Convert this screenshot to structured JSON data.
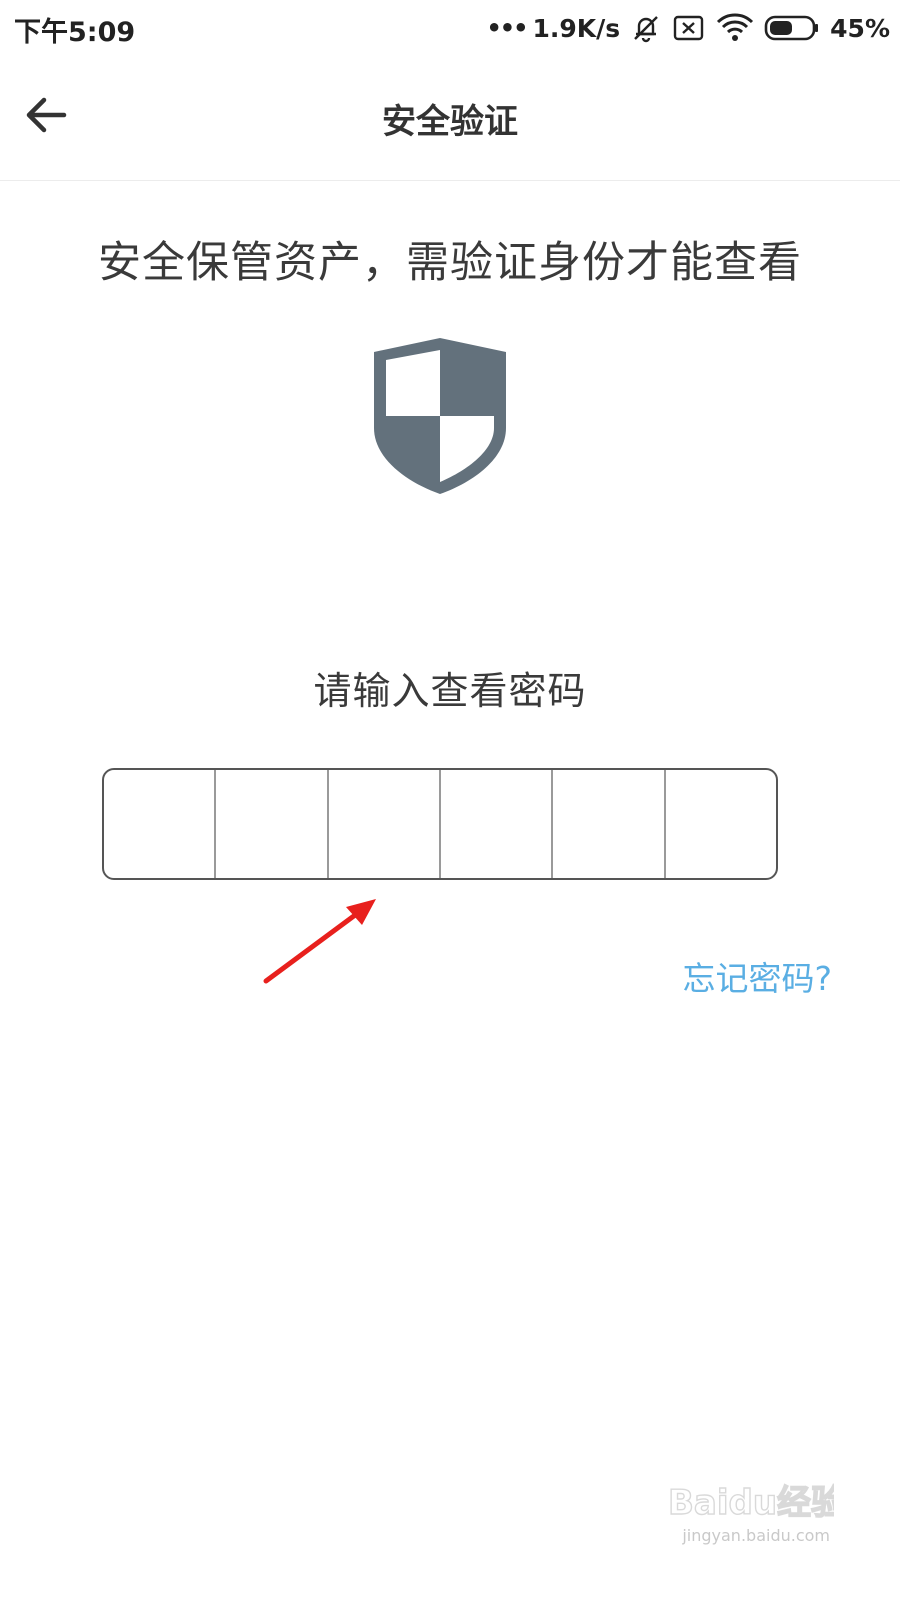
{
  "status_bar": {
    "time": "下午5:09",
    "signal_dots": "•••",
    "network_speed": "1.9K/s",
    "battery_percent": "45%",
    "icons": [
      "mute-bell-icon",
      "no-sim-icon",
      "wifi-icon",
      "battery-icon"
    ]
  },
  "header": {
    "title": "安全验证",
    "back_icon": "arrow-left-icon"
  },
  "main": {
    "headline": "安全保管资产，需验证身份才能查看",
    "shield_icon": "shield-icon",
    "shield_color": "#63717c",
    "prompt": "请输入查看密码",
    "pin_cells": [
      "",
      "",
      "",
      "",
      "",
      ""
    ],
    "forgot_password": "忘记密码?",
    "link_color": "#5aaee3",
    "annotation": "red-arrow-icon"
  },
  "watermark": {
    "logo": "Baidu经验",
    "caption": "jingyan.baidu.com"
  }
}
